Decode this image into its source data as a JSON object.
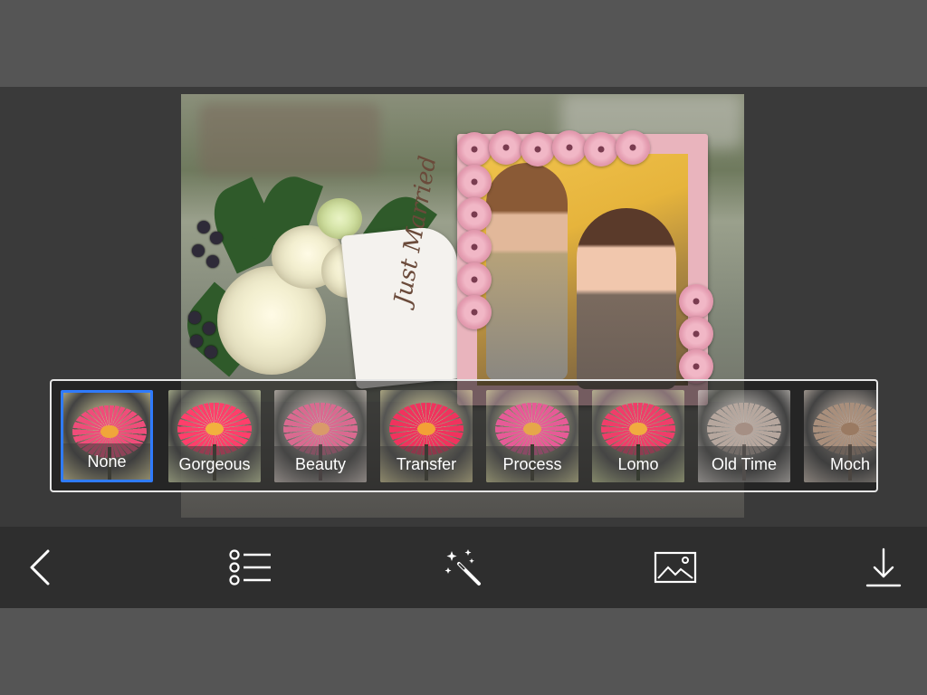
{
  "canvas": {
    "decorative_text": "Just Married"
  },
  "filters": {
    "selected": "None",
    "items": [
      {
        "label": "None",
        "tint": "#f2e9a8",
        "petal": "#ef4d7a",
        "center": "#f0a63a",
        "stem": "#3a3a2a"
      },
      {
        "label": "Gorgeous",
        "tint": "#e6f0b8",
        "petal": "#ff3f6b",
        "center": "#f2b13e",
        "stem": "#3d3a2a"
      },
      {
        "label": "Beauty",
        "tint": "#eadcd4",
        "petal": "#d96a90",
        "center": "#d99a6a",
        "stem": "#5a4a4a"
      },
      {
        "label": "Transfer",
        "tint": "#eee3a5",
        "petal": "#f0335e",
        "center": "#f3a136",
        "stem": "#3b3a2a"
      },
      {
        "label": "Process",
        "tint": "#e9e6a6",
        "petal": "#e65b97",
        "center": "#e6a74a",
        "stem": "#3a3a2a"
      },
      {
        "label": "Lomo",
        "tint": "#d9e2a2",
        "petal": "#ef3e6a",
        "center": "#f1ac3f",
        "stem": "#2f3a22"
      },
      {
        "label": "Old Time",
        "tint": "#e6e0da",
        "petal": "#b6a79e",
        "center": "#a58f84",
        "stem": "#6b635e"
      },
      {
        "label": "Moch",
        "tint": "#e6d6c8",
        "petal": "#a98f7c",
        "center": "#9a7a62",
        "stem": "#5e5046"
      }
    ]
  },
  "toolbar": {
    "back_icon": "chevron-left-icon",
    "list_icon": "list-icon",
    "magic_icon": "magic-wand-icon",
    "image_icon": "image-icon",
    "download_icon": "download-icon"
  },
  "colors": {
    "selected_border": "#2f7bff",
    "frame_pink": "#e9b4bd"
  }
}
